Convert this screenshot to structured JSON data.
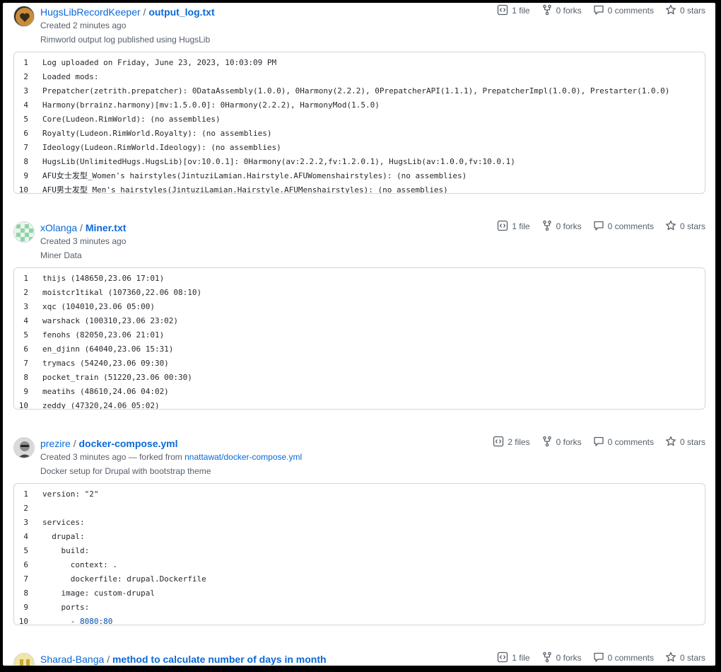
{
  "gists": [
    {
      "owner": "HugsLibRecordKeeper",
      "filename": "output_log.txt",
      "created": "Created 2 minutes ago",
      "fork_text": "",
      "fork_link": "",
      "description": "Rimworld output log published using HugsLib",
      "stats": {
        "files": "1 file",
        "forks": "0 forks",
        "comments": "0 comments",
        "stars": "0 stars"
      },
      "lines": [
        "Log uploaded on Friday, June 23, 2023, 10:03:09 PM",
        "Loaded mods:",
        "Prepatcher(zetrith.prepatcher): 0DataAssembly(1.0.0), 0Harmony(2.2.2), 0PrepatcherAPI(1.1.1), PrepatcherImpl(1.0.0), Prestarter(1.0.0)",
        "Harmony(brrainz.harmony)[mv:1.5.0.0]: 0Harmony(2.2.2), HarmonyMod(1.5.0)",
        "Core(Ludeon.RimWorld): (no assemblies)",
        "Royalty(Ludeon.RimWorld.Royalty): (no assemblies)",
        "Ideology(Ludeon.RimWorld.Ideology): (no assemblies)",
        "HugsLib(UnlimitedHugs.HugsLib)[ov:10.0.1]: 0Harmony(av:2.2.2,fv:1.2.0.1), HugsLib(av:1.0.0,fv:10.0.1)",
        "AFU女士发型_Women's hairstyles(JintuziLamian.Hairstyle.AFUWomenshairstyles): (no assemblies)",
        "AFU男士发型_Men's hairstyles(JintuziLamian.Hairstyle.AFUMenshairstyles): (no assemblies)"
      ]
    },
    {
      "owner": "xOlanga",
      "filename": "Miner.txt",
      "created": "Created 3 minutes ago",
      "fork_text": "",
      "fork_link": "",
      "description": "Miner Data",
      "stats": {
        "files": "1 file",
        "forks": "0 forks",
        "comments": "0 comments",
        "stars": "0 stars"
      },
      "lines": [
        "thijs (148650,23.06 17:01)",
        "moistcr1tikal (107360,22.06 08:10)",
        "xqc (104010,23.06 05:00)",
        "warshack (100310,23.06 23:02)",
        "fenohs (82050,23.06 21:01)",
        "en_djinn (64040,23.06 15:31)",
        "trymacs (54240,23.06 09:30)",
        "pocket_train (51220,23.06 00:30)",
        "meatihs (48610,24.06 04:02)",
        "zeddy (47320,24.06 05:02)"
      ]
    },
    {
      "owner": "prezire",
      "filename": "docker-compose.yml",
      "created": "Created 3 minutes ago",
      "fork_text": " — forked from ",
      "fork_link": "nnattawat/docker-compose.yml",
      "description": "Docker setup for Drupal with bootstrap theme",
      "stats": {
        "files": "2 files",
        "forks": "0 forks",
        "comments": "0 comments",
        "stars": "0 stars"
      },
      "lines": [
        "version: \"2\"",
        "",
        "services:",
        "  drupal:",
        "    build:",
        "      context: .",
        "      dockerfile: drupal.Dockerfile",
        "    image: custom-drupal",
        "    ports:",
        "      - 8080:80"
      ]
    },
    {
      "owner": "Sharad-Banga",
      "filename": "method to calculate number of days in month",
      "created": "",
      "fork_text": "",
      "fork_link": "",
      "description": "",
      "stats": {
        "files": "1 file",
        "forks": "0 forks",
        "comments": "0 comments",
        "stars": "0 stars"
      },
      "lines": []
    }
  ],
  "colors": {
    "link": "#0969da",
    "muted": "#57606a",
    "border": "#d0d7de",
    "number": "#0550ae"
  },
  "icons": [
    "code-square-icon",
    "fork-icon",
    "comment-icon",
    "star-icon"
  ]
}
